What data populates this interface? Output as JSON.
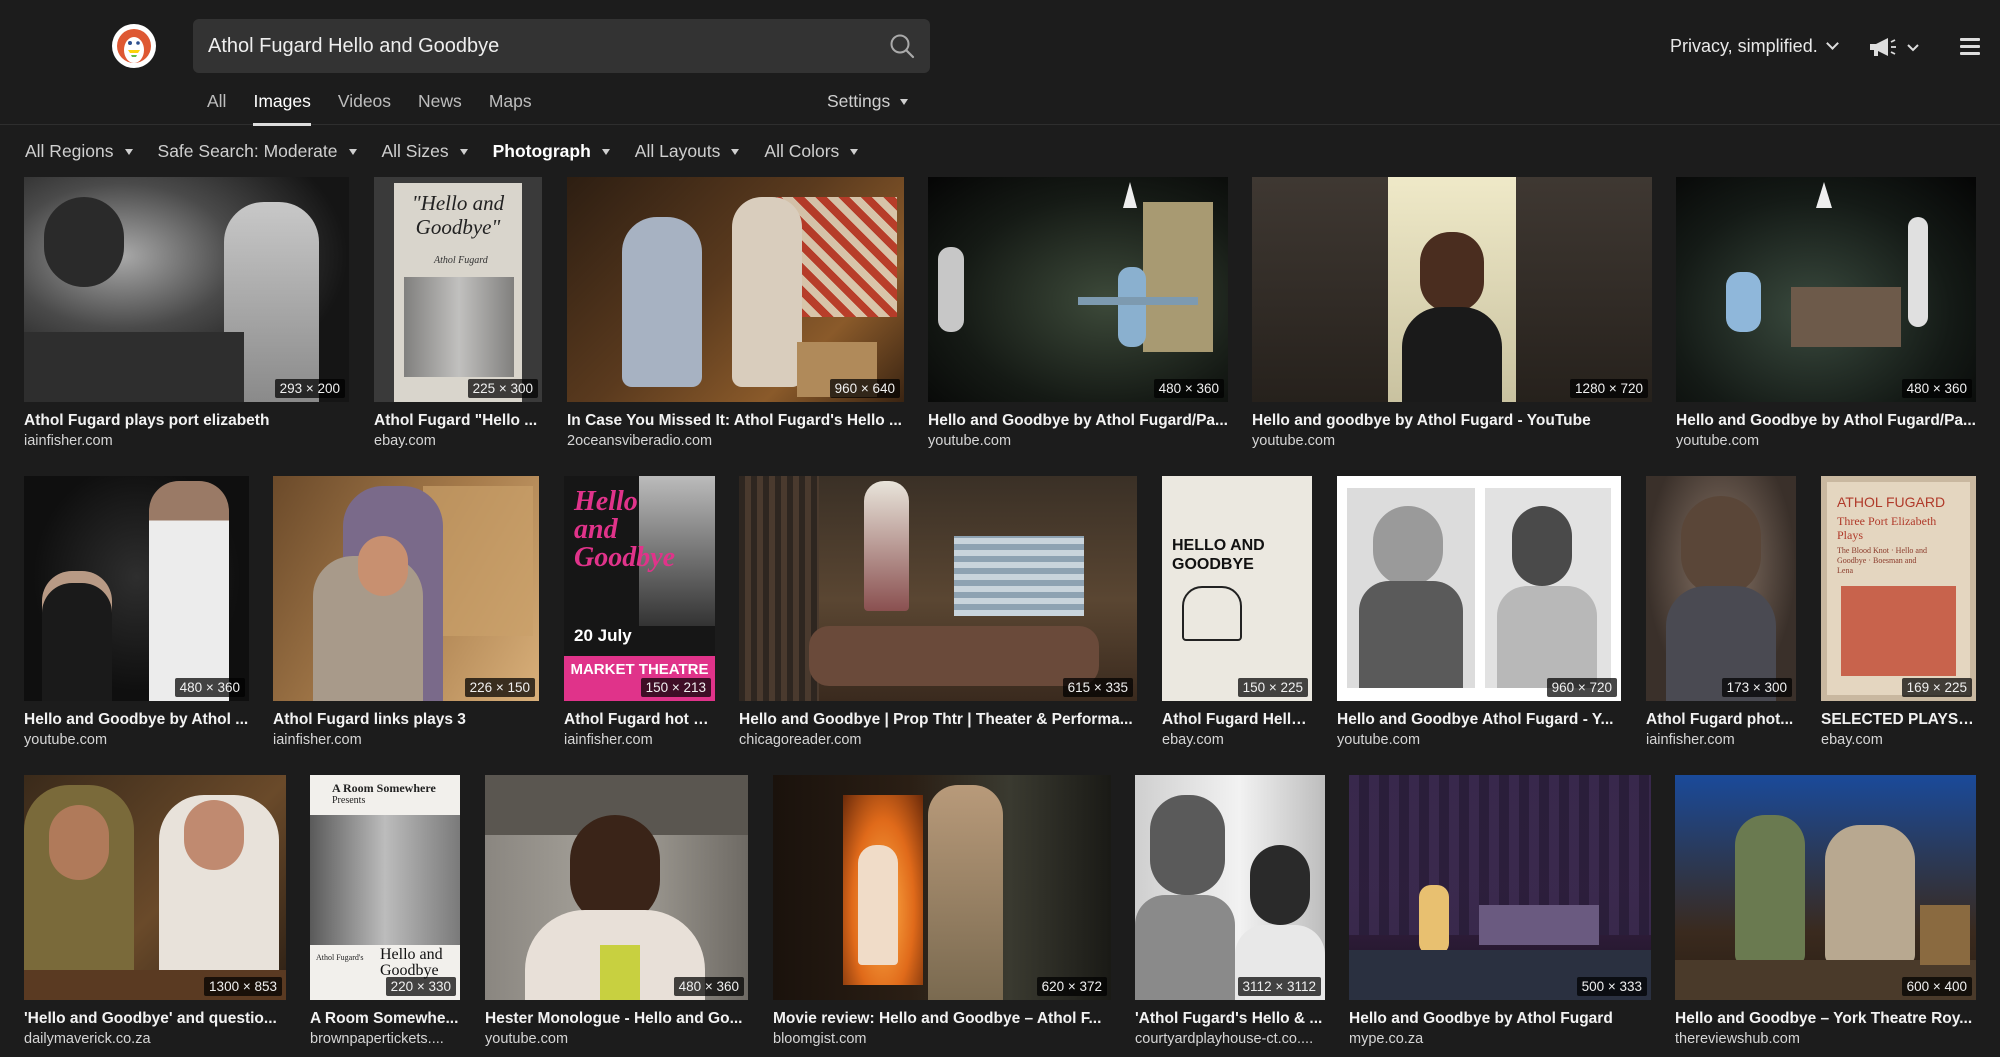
{
  "search": {
    "query": "Athol Fugard Hello and Goodbye"
  },
  "nav": {
    "tabs": [
      "All",
      "Images",
      "Videos",
      "News",
      "Maps"
    ],
    "active": "Images",
    "settings": "Settings"
  },
  "header": {
    "privacy": "Privacy, simplified."
  },
  "filters": [
    "All Regions",
    "Safe Search: Moderate",
    "All Sizes",
    "Photograph",
    "All Layouts",
    "All Colors"
  ],
  "results": [
    {
      "title": "Athol Fugard plays port elizabeth",
      "source": "iainfisher.com",
      "dims": "293 × 200"
    },
    {
      "title": "Athol Fugard \"Hello ...",
      "source": "ebay.com",
      "dims": "225 × 300"
    },
    {
      "title": "In Case You Missed It: Athol Fugard's Hello ...",
      "source": "2oceansviberadio.com",
      "dims": "960 × 640"
    },
    {
      "title": "Hello and Goodbye by Athol Fugard/Pa...",
      "source": "youtube.com",
      "dims": "480 × 360"
    },
    {
      "title": "Hello and goodbye by Athol Fugard - YouTube",
      "source": "youtube.com",
      "dims": "1280 × 720"
    },
    {
      "title": "Hello and Goodbye by Athol Fugard/Pa...",
      "source": "youtube.com",
      "dims": "480 × 360"
    },
    {
      "title": "Hello and Goodbye by Athol ...",
      "source": "youtube.com",
      "dims": "480 × 360"
    },
    {
      "title": "Athol Fugard links plays 3",
      "source": "iainfisher.com",
      "dims": "226 × 150"
    },
    {
      "title": "Athol Fugard hot n...",
      "source": "iainfisher.com",
      "dims": "150 × 213"
    },
    {
      "title": "Hello and Goodbye | Prop Thtr | Theater & Performa...",
      "source": "chicagoreader.com",
      "dims": "615 × 335"
    },
    {
      "title": "Athol Fugard Hello...",
      "source": "ebay.com",
      "dims": "150 × 225"
    },
    {
      "title": "Hello and Goodbye Athol Fugard - Y...",
      "source": "youtube.com",
      "dims": "960 × 720"
    },
    {
      "title": "Athol Fugard phot...",
      "source": "iainfisher.com",
      "dims": "173 × 300"
    },
    {
      "title": "SELECTED PLAYS: ...",
      "source": "ebay.com",
      "dims": "169 × 225"
    },
    {
      "title": "'Hello and Goodbye' and questio...",
      "source": "dailymaverick.co.za",
      "dims": "1300 × 853"
    },
    {
      "title": "A Room Somewhe...",
      "source": "brownpapertickets....",
      "dims": "220 × 330"
    },
    {
      "title": "Hester Monologue - Hello and Go...",
      "source": "youtube.com",
      "dims": "480 × 360"
    },
    {
      "title": "Movie review: Hello and Goodbye – Athol F...",
      "source": "bloomgist.com",
      "dims": "620 × 372"
    },
    {
      "title": "'Athol Fugard's Hello & ...",
      "source": "courtyardplayhouse-ct.co....",
      "dims": "3112 × 3112"
    },
    {
      "title": "Hello and Goodbye by Athol Fugard",
      "source": "mype.co.za",
      "dims": "500 × 333"
    },
    {
      "title": "Hello and Goodbye – York Theatre Roy...",
      "source": "thereviewshub.com",
      "dims": "600 × 400"
    }
  ],
  "covers": {
    "ebay1_title": "\"Hello and Goodbye\"",
    "ebay1_author": "Athol Fugard",
    "ebay2_title": "HELLO AND GOODBYE",
    "book_author": "ATHOL FUGARD",
    "book_title": "Three Port Elizabeth Plays",
    "book_sub": "The Blood Knot · Hello and Goodbye · Boesman and Lena",
    "poster_title": "Hello and Goodbye",
    "poster_date": "20 July",
    "poster_venue": "MARKET THEATRE",
    "room_top": "A Room Somewhere",
    "room_presents": "Presents",
    "room_title": "Hello and Goodbye",
    "room_author": "Athol Fugard's"
  }
}
